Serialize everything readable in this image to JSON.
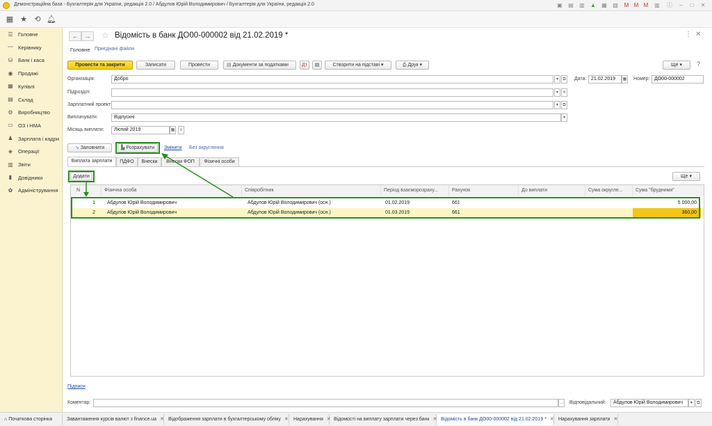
{
  "window_title": "Демонстраційна база - Бухгалтерія для України, редакція 2.0 / Абдулов Юрій Володимирович / Бухгалтерія для України, редакція 2.0",
  "sidebar": {
    "items": [
      {
        "label": "Головне",
        "icon": "menu-icon"
      },
      {
        "label": "Керівнику",
        "icon": "chart-icon"
      },
      {
        "label": "Банк і каса",
        "icon": "bank-icon"
      },
      {
        "label": "Продажі",
        "icon": "sales-icon"
      },
      {
        "label": "Купівлі",
        "icon": "cart-icon"
      },
      {
        "label": "Склад",
        "icon": "warehouse-icon"
      },
      {
        "label": "Виробництво",
        "icon": "production-icon"
      },
      {
        "label": "ОЗ і НМА",
        "icon": "assets-icon"
      },
      {
        "label": "Зарплата і кадри",
        "icon": "people-icon"
      },
      {
        "label": "Операції",
        "icon": "operations-icon"
      },
      {
        "label": "Звіти",
        "icon": "reports-icon"
      },
      {
        "label": "Довідники",
        "icon": "book-icon"
      },
      {
        "label": "Адміністрування",
        "icon": "gear-icon"
      }
    ]
  },
  "document": {
    "title": "Відомість в банк ДО00-000002 від 21.02.2019 *",
    "top_tabs": {
      "main": "Головне",
      "attached": "Приєднані файли"
    },
    "toolbar": {
      "post_close": "Провести та закрити",
      "save": "Записати",
      "post": "Провести",
      "tax_docs": "Документи за податками",
      "create_based": "Створити на підставі",
      "print": "Друк",
      "more": "Ще"
    },
    "fields": {
      "org_label": "Організація:",
      "org_value": "Добро",
      "date_label": "Дата:",
      "date_value": "21.02.2019",
      "number_label": "Номер:",
      "number_value": "ДО00-000002",
      "subdivision_label": "Підрозділ:",
      "subdivision_value": "",
      "project_label": "Зарплатний проект:",
      "project_value": "",
      "pay_label": "Виплачувати:",
      "pay_value": "Відпускні",
      "month_label": "Місяць виплати:",
      "month_value": "Лютий 2019"
    },
    "actions": {
      "fill": "Заповнити",
      "calculate": "Розрахувати",
      "change": "Змінити",
      "no_rounding": "Без округлення"
    },
    "form_tabs": [
      "Виплата зарплати",
      "ПДФО",
      "Внески",
      "Внески ФОП",
      "Фізичні особи"
    ],
    "add_button": "Додати",
    "table_more": "Ще",
    "table": {
      "columns": [
        "N",
        "Фізична особа",
        "Співробітник",
        "Період взаєморозраху...",
        "Рахунок",
        "До виплати",
        "Сума округле...",
        "Сума \"брудними\""
      ],
      "rows": [
        {
          "n": "1",
          "person": "Абдулов Юрій Володимирович",
          "employee": "Абдулов Юрій Володимирович (осн.)",
          "period": "01.02.2019",
          "account": "661",
          "to_pay": "",
          "rounding": "",
          "gross": "5 000,00"
        },
        {
          "n": "2",
          "person": "Абдулов Юрій Володимирович",
          "employee": "Абдулов Юрій Володимирович (осн.)",
          "period": "01.03.2019",
          "account": "661",
          "to_pay": "",
          "rounding": "",
          "gross": "360,00"
        }
      ]
    },
    "signatures_link": "Підписи",
    "comment_label": "Коментар:",
    "comment_value": "",
    "responsible_label": "Відповідальний:",
    "responsible_value": "Абдулов Юрій Володимирович"
  },
  "bottom_tabs": [
    {
      "label": "Початкова сторінка",
      "closable": false
    },
    {
      "label": "Завантаження курсів валют з finance.ua",
      "closable": true
    },
    {
      "label": "Відображення зарплати в бухгалтерському обліку",
      "closable": true
    },
    {
      "label": "Нарахування",
      "closable": true
    },
    {
      "label": "Відомості на виплату зарплати через банк",
      "closable": true
    },
    {
      "label": "Відомість в банк ДО00-000002 від 21.02.2019 *",
      "closable": true,
      "active": true
    },
    {
      "label": "Нарахування зарплати",
      "closable": true
    }
  ],
  "colors": {
    "accent": "#f1c812",
    "annotation": "#2a8f1e",
    "sidebar_bg": "#fbf3cf",
    "link": "#1b4ea0"
  }
}
